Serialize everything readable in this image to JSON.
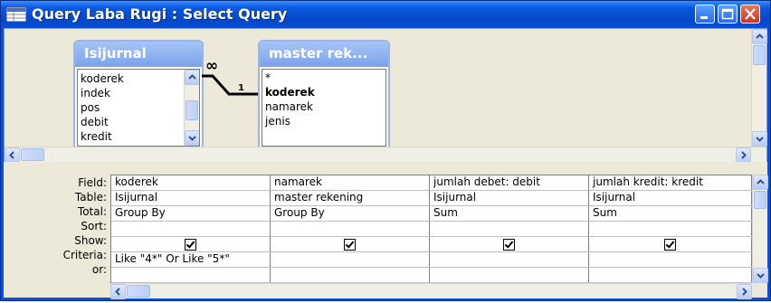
{
  "window": {
    "title": "Query Laba Rugi : Select Query"
  },
  "tables": [
    {
      "name": "Isijurnal",
      "fields": [
        "koderek",
        "indek",
        "pos",
        "debit",
        "kredit"
      ],
      "key_field": ""
    },
    {
      "name": "master rek...",
      "fields": [
        "*",
        "koderek",
        "namarek",
        "jenis"
      ],
      "key_field": "koderek"
    }
  ],
  "relationship": {
    "left_symbol": "∞",
    "right_symbol": "1"
  },
  "grid": {
    "row_labels": [
      "Field:",
      "Table:",
      "Total:",
      "Sort:",
      "Show:",
      "Criteria:",
      "or:"
    ],
    "columns": [
      {
        "field": "koderek",
        "table": "Isijurnal",
        "total": "Group By",
        "sort": "",
        "show": true,
        "criteria": "Like \"4*\" Or Like \"5*\"",
        "or": ""
      },
      {
        "field": "namarek",
        "table": "master rekening",
        "total": "Group By",
        "sort": "",
        "show": true,
        "criteria": "",
        "or": ""
      },
      {
        "field": "jumlah debet: debit",
        "table": "Isijurnal",
        "total": "Sum",
        "sort": "",
        "show": true,
        "criteria": "",
        "or": ""
      },
      {
        "field": "jumlah kredit: kredit",
        "table": "Isijurnal",
        "total": "Sum",
        "sort": "",
        "show": true,
        "criteria": "",
        "or": ""
      }
    ]
  },
  "colors": {
    "titlebar": "#0a4fd8",
    "table_header": "#7ba2ea",
    "panel": "#ece9d8"
  }
}
